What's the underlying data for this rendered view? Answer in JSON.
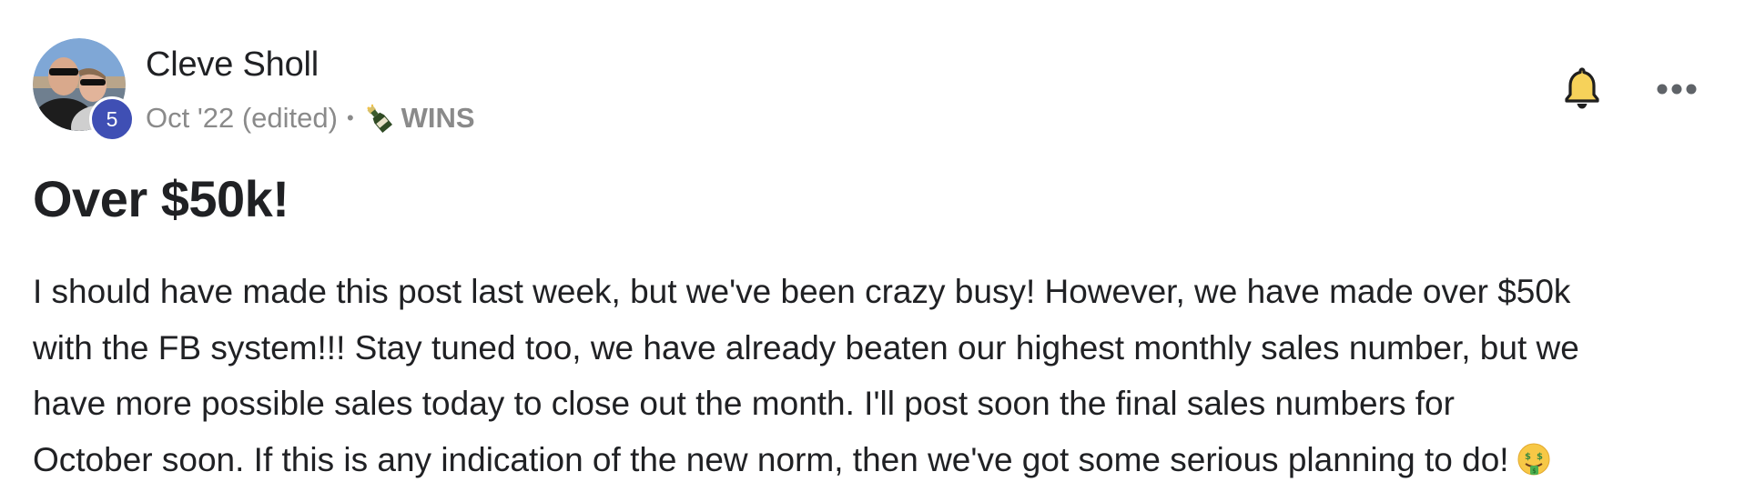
{
  "post": {
    "author": {
      "name": "Cleve Sholl",
      "level": "5",
      "avatar_icon": "user-photo-avatar"
    },
    "meta": {
      "date": "Oct '22 (edited)",
      "separator": "•",
      "category_icon": "champagne-bottle-icon",
      "category": "WINS"
    },
    "actions": {
      "bell_icon": "bell-icon",
      "more_icon": "more-options-icon"
    },
    "title": "Over $50k!",
    "body_lines": [
      "I should have made this post last week, but we've been crazy busy! However, we have made over $50k",
      "with the FB system!!! Stay tuned too, we have already beaten our highest monthly sales number, but we",
      "have more possible sales today to close out the month. I'll post soon the final sales numbers for",
      "October soon. If this is any indication of the new norm, then we've got some serious planning to do!"
    ],
    "end_emoji": "money-mouth-face-emoji"
  },
  "colors": {
    "text": "#202124",
    "muted": "#8a8a8a",
    "badge": "#3f4fb4",
    "icon": "#1f1f1f"
  }
}
